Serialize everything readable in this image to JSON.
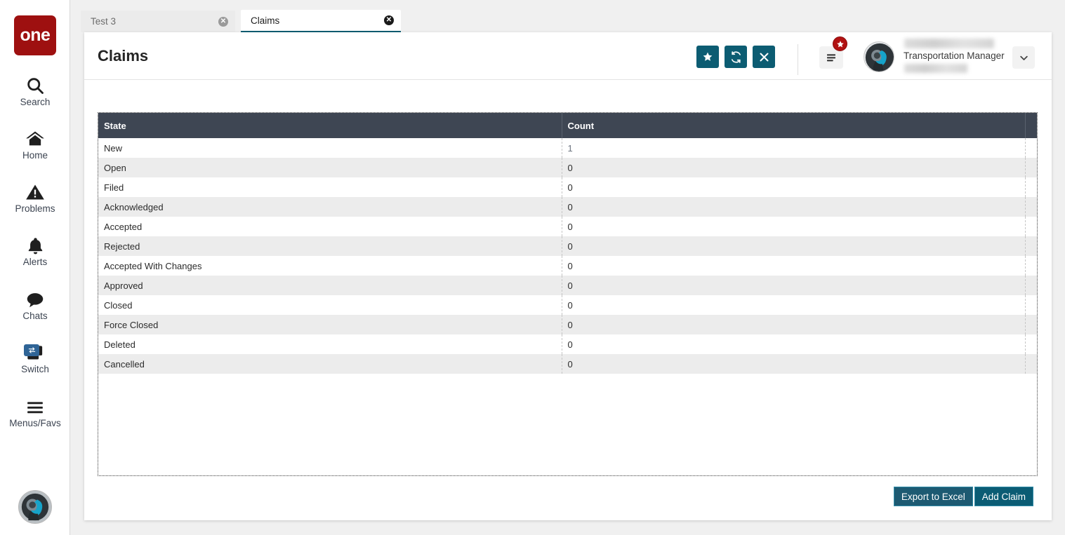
{
  "brand": {
    "logo_text": "one"
  },
  "sidebar": {
    "items": [
      {
        "label": "Search",
        "icon": "search-icon"
      },
      {
        "label": "Home",
        "icon": "home-icon"
      },
      {
        "label": "Problems",
        "icon": "warning-triangle-icon"
      },
      {
        "label": "Alerts",
        "icon": "bell-icon"
      },
      {
        "label": "Chats",
        "icon": "chat-bubble-icon"
      },
      {
        "label": "Switch",
        "icon": "switch-windows-icon",
        "badge_icon": "exchange-arrows-icon"
      },
      {
        "label": "Menus/Favs",
        "icon": "hamburger-icon"
      }
    ],
    "avatar_icon": "user-avatar"
  },
  "tabs": [
    {
      "label": "Test 3",
      "active": false,
      "close_icon": "close-circle-icon"
    },
    {
      "label": "Claims",
      "active": true,
      "close_icon": "close-circle-icon"
    }
  ],
  "header": {
    "title": "Claims",
    "actions": [
      {
        "name": "favorite-button",
        "icon": "star-icon"
      },
      {
        "name": "refresh-button",
        "icon": "refresh-icon"
      },
      {
        "name": "close-button",
        "icon": "x-icon"
      }
    ],
    "menu_button": {
      "icon": "hamburger-icon",
      "badge_icon": "star-icon"
    },
    "user": {
      "role": "Transportation Manager",
      "name_hidden": "",
      "org_hidden": "",
      "caret_icon": "chevron-down-icon"
    }
  },
  "table": {
    "columns": [
      "State",
      "Count",
      ""
    ],
    "rows": [
      {
        "state": "New",
        "count": "1"
      },
      {
        "state": "Open",
        "count": "0"
      },
      {
        "state": "Filed",
        "count": "0"
      },
      {
        "state": "Acknowledged",
        "count": "0"
      },
      {
        "state": "Accepted",
        "count": "0"
      },
      {
        "state": "Rejected",
        "count": "0"
      },
      {
        "state": "Accepted With Changes",
        "count": "0"
      },
      {
        "state": "Approved",
        "count": "0"
      },
      {
        "state": "Closed",
        "count": "0"
      },
      {
        "state": "Force Closed",
        "count": "0"
      },
      {
        "state": "Deleted",
        "count": "0"
      },
      {
        "state": "Cancelled",
        "count": "0"
      }
    ]
  },
  "footer": {
    "export_label": "Export to Excel",
    "add_label": "Add Claim"
  },
  "colors": {
    "brand_red": "#9e1010",
    "teal": "#0c5c72",
    "table_header": "#3e4653",
    "badge_red": "#b11212",
    "switch_badge_blue": "#2f6496",
    "page_bg": "#f0f0f0"
  }
}
